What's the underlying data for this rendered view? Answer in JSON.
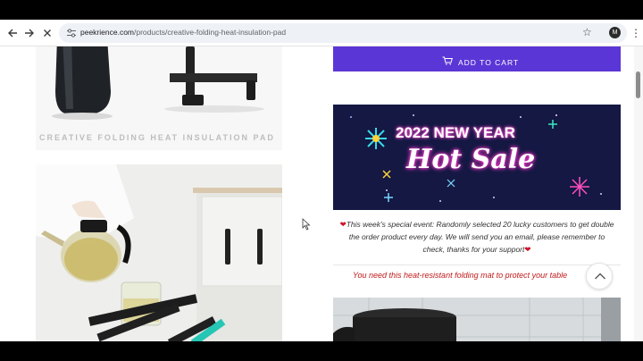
{
  "browser": {
    "url_host": "peekrience.com",
    "url_path": "/products/creative-folding-heat-insulation-pad",
    "profile_initial": "M",
    "icons": [
      "back-arrow-icon",
      "forward-arrow-icon",
      "close-icon",
      "tune-icon",
      "star-icon",
      "kebab-menu-icon"
    ]
  },
  "product": {
    "image_caption": "CREATIVE FOLDING HEAT INSULATION PAD",
    "add_to_cart_label": "ADD TO CART",
    "banner": {
      "line1": "2022 NEW YEAR",
      "line2": "Hot Sale"
    },
    "promo_text": "This week's special event: Randomly selected 20 lucky customers to get double the order product every day. We will send you an email, please remember to check, thanks for your support",
    "pitch_text": "You need this heat-resistant folding mat to protect your table"
  },
  "colors": {
    "accent": "#5b36d6",
    "banner_bg": "#121540",
    "pitch_red": "#c01a1a",
    "heart_red": "#d0112b"
  }
}
